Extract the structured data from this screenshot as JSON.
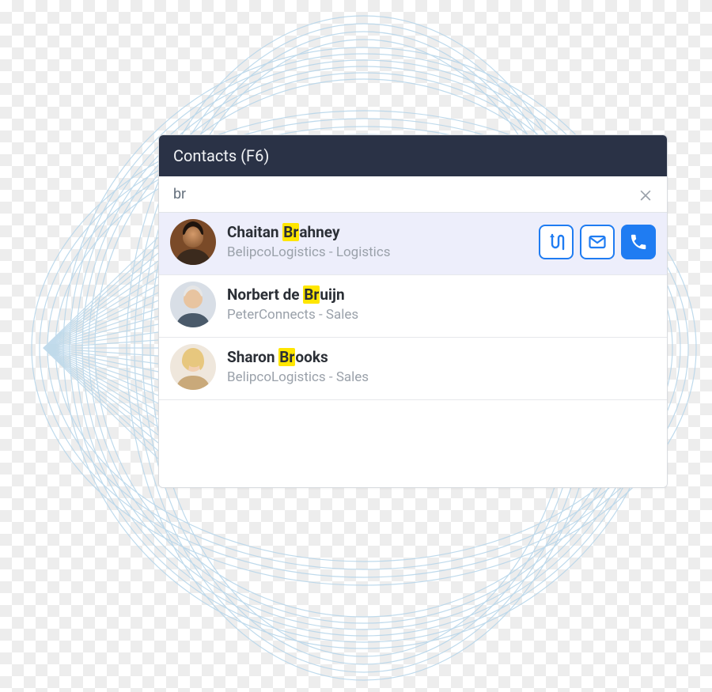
{
  "panel": {
    "title": "Contacts (F6)"
  },
  "search": {
    "value": "br"
  },
  "actions": {
    "transfer": "transfer",
    "email": "email",
    "call": "call"
  },
  "contacts": [
    {
      "name_pre": "Chaitan ",
      "name_hl": "Br",
      "name_post": "ahney",
      "sub": "BelipcoLogistics - Logistics",
      "selected": true
    },
    {
      "name_pre": "Norbert de ",
      "name_hl": "Br",
      "name_post": "uijn",
      "sub": "PeterConnects - Sales",
      "selected": false
    },
    {
      "name_pre": "Sharon ",
      "name_hl": "Br",
      "name_post": "ooks",
      "sub": "BelipcoLogistics - Sales",
      "selected": false
    }
  ]
}
